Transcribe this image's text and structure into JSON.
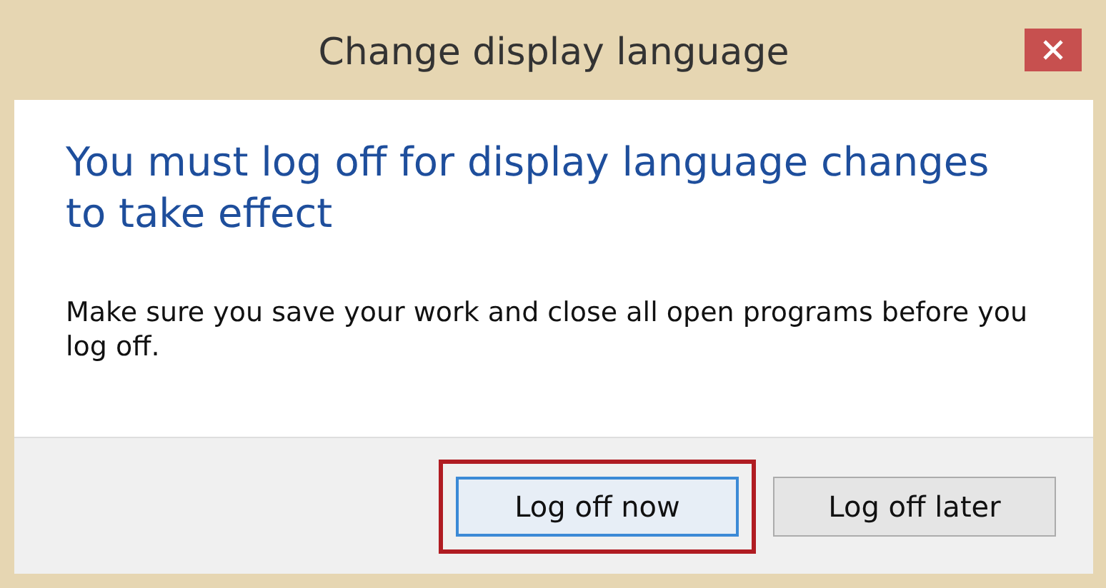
{
  "window": {
    "title": "Change display language"
  },
  "heading": "You must log off for display language changes to take effect",
  "message": "Make sure you save your work and close all open programs before you log off.",
  "buttons": [
    {
      "label": "Log off now",
      "default": true,
      "highlighted": true
    },
    {
      "label": "Log off later",
      "default": false,
      "highlighted": false
    }
  ]
}
